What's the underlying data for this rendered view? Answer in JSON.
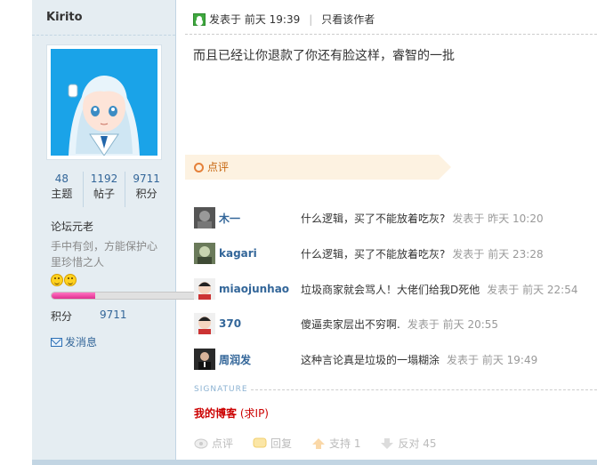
{
  "user": {
    "name": "Kirito",
    "stats": [
      {
        "value": "48",
        "label": "主题"
      },
      {
        "value": "1192",
        "label": "帖子"
      },
      {
        "value": "9711",
        "label": "积分"
      }
    ],
    "rank": "论坛元老",
    "signature_text": "手中有剑，方能保护心里珍惜之人",
    "credit_label": "积分",
    "credit_value": "9711",
    "progress": 0.3,
    "send_message": "发消息"
  },
  "post": {
    "posted": "发表于 前天 19:39",
    "author_only": "只看该作者",
    "content": "而且已经让你退款了你还有脸这样，睿智的一批"
  },
  "comments_title": "点评",
  "comments": [
    {
      "name": "木一",
      "text": "什么逻辑，买了不能放着吃灰?",
      "time": "发表于 昨天 10:20"
    },
    {
      "name": "kagari",
      "text": "什么逻辑，买了不能放着吃灰?",
      "time": "发表于 前天 23:28"
    },
    {
      "name": "miaojunhao",
      "text": "垃圾商家就会骂人！大佬们给我D死他",
      "time": "发表于 前天 22:54"
    },
    {
      "name": "370",
      "text": "傻逼卖家层出不穷啊.",
      "time": "发表于 前天 20:55"
    },
    {
      "name": "周润发",
      "text": "这种言论真是垃圾的一塌糊涂",
      "time": "发表于 前天 19:49"
    }
  ],
  "signature_label": "SIGNATURE",
  "signature_link": "我的博客",
  "signature_note": "(求IP)",
  "actions": {
    "rate": "点评",
    "reply": "回复",
    "support": "支持 1",
    "oppose": "反对 45"
  },
  "colors": {
    "sidebar_bg": "#e5edf2",
    "link": "#336699",
    "banner_bg": "#fdf2e1",
    "banner_text": "#c7660f",
    "progress": "#e0308f"
  }
}
